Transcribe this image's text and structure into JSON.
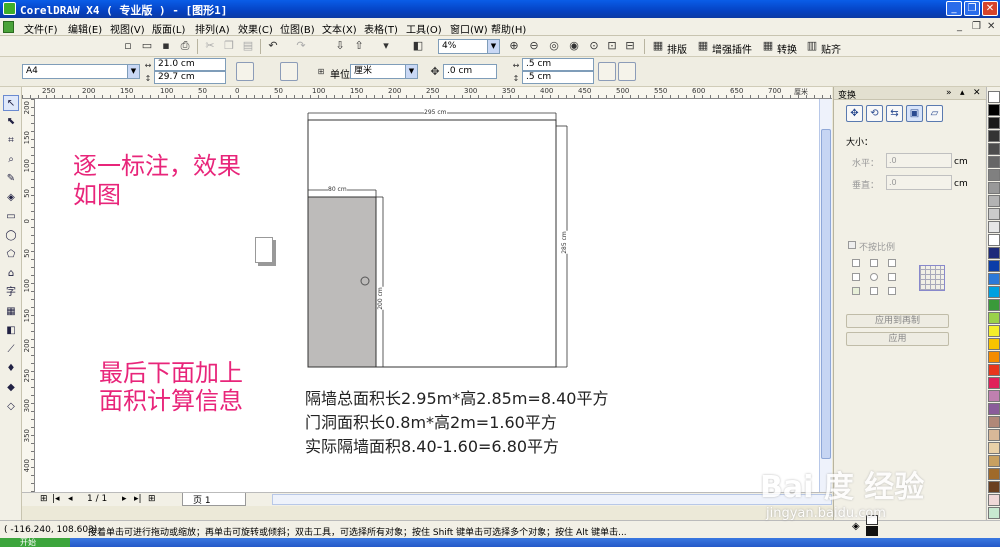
{
  "window": {
    "title": "CorelDRAW X4 ( 专业版 ) - [图形1]",
    "minimize": "_",
    "restore": "❐",
    "close": "✕"
  },
  "menu": {
    "items": [
      "文件(F)",
      "编辑(E)",
      "视图(V)",
      "版面(L)",
      "排列(A)",
      "效果(C)",
      "位图(B)",
      "文本(X)",
      "表格(T)",
      "工具(O)",
      "窗口(W)",
      "帮助(H)"
    ],
    "mdi_minimize": "_",
    "mdi_restore": "❐",
    "mdi_close": "✕"
  },
  "toolbar1": {
    "zoom_value": "4%",
    "btn_layout": "排版",
    "btn_plugin": "增强插件",
    "btn_convert": "转换",
    "btn_snap": "贴齐"
  },
  "toolbar2": {
    "page_size": "A4",
    "width": "21.0 cm",
    "height": "29.7 cm",
    "unit_label": "单位:",
    "unit_value": "厘米",
    "nudge": ".0 cm",
    "dup_x": ".5 cm",
    "dup_y": ".5 cm"
  },
  "ruler": {
    "h_ticks": [
      "250",
      "200",
      "150",
      "100",
      "50",
      "0",
      "50",
      "100",
      "150",
      "200",
      "250",
      "300",
      "350",
      "400",
      "450",
      "500",
      "550",
      "600",
      "650",
      "700"
    ],
    "v_ticks": [
      "200",
      "150",
      "100",
      "50",
      "0",
      "50",
      "100",
      "150",
      "200",
      "250",
      "300",
      "350",
      "400"
    ],
    "h_unit": "厘米",
    "v_unit": "厘米"
  },
  "canvas": {
    "note1_line1": "逐一标注，效果",
    "note1_line2": "如图",
    "note2_line1": "最后下面加上",
    "note2_line2": "面积计算信息",
    "dim_wall_width": "295 cm",
    "dim_wall_height": "285 cm",
    "dim_door_width": "80 cm",
    "dim_door_height": "200 cm",
    "calc_line1": "隔墙总面积长2.95m*高2.85m=8.40平方",
    "calc_line2": "门洞面积长0.8m*高2m=1.60平方",
    "calc_line3": "实际隔墙面积8.40-1.60=6.80平方"
  },
  "pagebar": {
    "page_counter": "1 / 1",
    "page_tab": "页 1"
  },
  "docker": {
    "title": "变换",
    "size_label": "大小：",
    "h_label": "水平：",
    "v_label": "垂直：",
    "h_value": ".0",
    "v_value": ".0",
    "unit": "cm",
    "proportional": "不按比例",
    "apply_to_dup": "应用到再制",
    "apply": "应用"
  },
  "status": {
    "coords": "( -116.240, 108.603)",
    "hint": "接着单击可进行拖动或缩放；再单击可旋转或倾斜；双击工具，可选择所有对象；按住 Shift 键单击可选择多个对象；按住 Alt 键单击..."
  },
  "taskbar": {
    "start": "开始"
  },
  "palette": {
    "colors": [
      "#ffffff",
      "#000000",
      "#1a1a1a",
      "#333333",
      "#4d4d4d",
      "#666666",
      "#808080",
      "#999999",
      "#b3b3b3",
      "#cccccc",
      "#e6e6e6",
      "#ffffff",
      "#1e2a7a",
      "#0b3da8",
      "#2c79d8",
      "#00a0e0",
      "#3a9a3a",
      "#9ad04a",
      "#f4ee2a",
      "#f8c400",
      "#f48c00",
      "#e8361c",
      "#e0205a",
      "#c080b0",
      "#8a5c9a",
      "#b08878",
      "#d8b898",
      "#e8d0a8",
      "#c8a060",
      "#a06a2a",
      "#6a4020",
      "#f0d8d8",
      "#c8e8d0"
    ]
  },
  "watermark": {
    "brand": "Bai 度 经验",
    "url": "jingyan.baidu.com"
  }
}
